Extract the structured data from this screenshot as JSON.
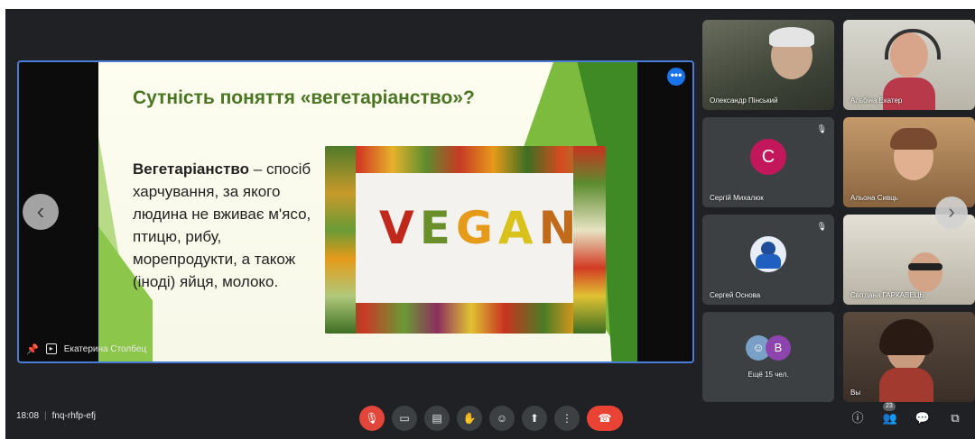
{
  "slide": {
    "title": "Сутність поняття «вегетаріанство»?",
    "body_term": "Вегетаріанство",
    "body_rest": " – спосіб харчування, за якого людина не вживає м'ясо, птицю, рибу, морепродукти, а також (іноді) яйця, молоко.",
    "photo_word": [
      "V",
      "E",
      "G",
      "A",
      "N"
    ]
  },
  "presenter": {
    "name": "Екатерина Столбец"
  },
  "participants": [
    {
      "name": "Олександр Пінський",
      "type": "video"
    },
    {
      "name": "Альбіна Екатер",
      "type": "video"
    },
    {
      "name": "Сергій Михалюк",
      "type": "avatar",
      "initial": "С"
    },
    {
      "name": "Альона Сивць",
      "type": "video"
    },
    {
      "name": "Сергей Основа",
      "type": "avatar",
      "initial": ""
    },
    {
      "name": "Світлана ГАРКАВЕЦЬ",
      "type": "video"
    },
    {
      "name": "Ещё 15 чел.",
      "type": "more",
      "initial": "В"
    },
    {
      "name": "Вы",
      "type": "video"
    }
  ],
  "meeting": {
    "time": "18:08",
    "code": "fnq-rhfp-efj",
    "participant_count": "23"
  },
  "icons": {
    "mic": "mic-off-icon",
    "camera": "camera-icon",
    "captions": "captions-icon",
    "hand": "raise-hand-icon",
    "emoji": "emoji-icon",
    "present": "present-icon",
    "more": "more-options-icon",
    "end": "end-call-icon"
  },
  "colors": {
    "background": "#202124",
    "accent": "#1a73e8",
    "end_call": "#ea4335",
    "slide_title": "#4a7523"
  }
}
